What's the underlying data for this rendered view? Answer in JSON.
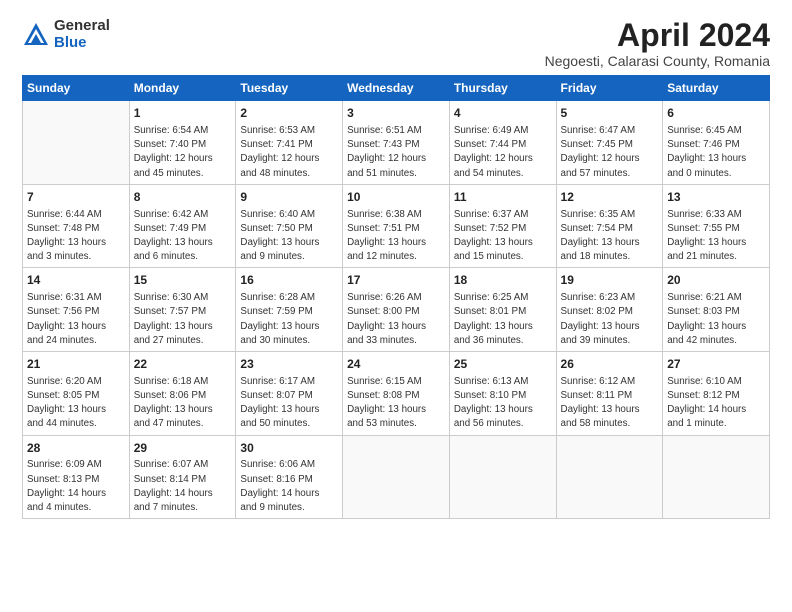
{
  "logo": {
    "general": "General",
    "blue": "Blue"
  },
  "title": "April 2024",
  "subtitle": "Negoesti, Calarasi County, Romania",
  "days_header": [
    "Sunday",
    "Monday",
    "Tuesday",
    "Wednesday",
    "Thursday",
    "Friday",
    "Saturday"
  ],
  "weeks": [
    [
      {
        "num": "",
        "info": ""
      },
      {
        "num": "1",
        "info": "Sunrise: 6:54 AM\nSunset: 7:40 PM\nDaylight: 12 hours\nand 45 minutes."
      },
      {
        "num": "2",
        "info": "Sunrise: 6:53 AM\nSunset: 7:41 PM\nDaylight: 12 hours\nand 48 minutes."
      },
      {
        "num": "3",
        "info": "Sunrise: 6:51 AM\nSunset: 7:43 PM\nDaylight: 12 hours\nand 51 minutes."
      },
      {
        "num": "4",
        "info": "Sunrise: 6:49 AM\nSunset: 7:44 PM\nDaylight: 12 hours\nand 54 minutes."
      },
      {
        "num": "5",
        "info": "Sunrise: 6:47 AM\nSunset: 7:45 PM\nDaylight: 12 hours\nand 57 minutes."
      },
      {
        "num": "6",
        "info": "Sunrise: 6:45 AM\nSunset: 7:46 PM\nDaylight: 13 hours\nand 0 minutes."
      }
    ],
    [
      {
        "num": "7",
        "info": "Sunrise: 6:44 AM\nSunset: 7:48 PM\nDaylight: 13 hours\nand 3 minutes."
      },
      {
        "num": "8",
        "info": "Sunrise: 6:42 AM\nSunset: 7:49 PM\nDaylight: 13 hours\nand 6 minutes."
      },
      {
        "num": "9",
        "info": "Sunrise: 6:40 AM\nSunset: 7:50 PM\nDaylight: 13 hours\nand 9 minutes."
      },
      {
        "num": "10",
        "info": "Sunrise: 6:38 AM\nSunset: 7:51 PM\nDaylight: 13 hours\nand 12 minutes."
      },
      {
        "num": "11",
        "info": "Sunrise: 6:37 AM\nSunset: 7:52 PM\nDaylight: 13 hours\nand 15 minutes."
      },
      {
        "num": "12",
        "info": "Sunrise: 6:35 AM\nSunset: 7:54 PM\nDaylight: 13 hours\nand 18 minutes."
      },
      {
        "num": "13",
        "info": "Sunrise: 6:33 AM\nSunset: 7:55 PM\nDaylight: 13 hours\nand 21 minutes."
      }
    ],
    [
      {
        "num": "14",
        "info": "Sunrise: 6:31 AM\nSunset: 7:56 PM\nDaylight: 13 hours\nand 24 minutes."
      },
      {
        "num": "15",
        "info": "Sunrise: 6:30 AM\nSunset: 7:57 PM\nDaylight: 13 hours\nand 27 minutes."
      },
      {
        "num": "16",
        "info": "Sunrise: 6:28 AM\nSunset: 7:59 PM\nDaylight: 13 hours\nand 30 minutes."
      },
      {
        "num": "17",
        "info": "Sunrise: 6:26 AM\nSunset: 8:00 PM\nDaylight: 13 hours\nand 33 minutes."
      },
      {
        "num": "18",
        "info": "Sunrise: 6:25 AM\nSunset: 8:01 PM\nDaylight: 13 hours\nand 36 minutes."
      },
      {
        "num": "19",
        "info": "Sunrise: 6:23 AM\nSunset: 8:02 PM\nDaylight: 13 hours\nand 39 minutes."
      },
      {
        "num": "20",
        "info": "Sunrise: 6:21 AM\nSunset: 8:03 PM\nDaylight: 13 hours\nand 42 minutes."
      }
    ],
    [
      {
        "num": "21",
        "info": "Sunrise: 6:20 AM\nSunset: 8:05 PM\nDaylight: 13 hours\nand 44 minutes."
      },
      {
        "num": "22",
        "info": "Sunrise: 6:18 AM\nSunset: 8:06 PM\nDaylight: 13 hours\nand 47 minutes."
      },
      {
        "num": "23",
        "info": "Sunrise: 6:17 AM\nSunset: 8:07 PM\nDaylight: 13 hours\nand 50 minutes."
      },
      {
        "num": "24",
        "info": "Sunrise: 6:15 AM\nSunset: 8:08 PM\nDaylight: 13 hours\nand 53 minutes."
      },
      {
        "num": "25",
        "info": "Sunrise: 6:13 AM\nSunset: 8:10 PM\nDaylight: 13 hours\nand 56 minutes."
      },
      {
        "num": "26",
        "info": "Sunrise: 6:12 AM\nSunset: 8:11 PM\nDaylight: 13 hours\nand 58 minutes."
      },
      {
        "num": "27",
        "info": "Sunrise: 6:10 AM\nSunset: 8:12 PM\nDaylight: 14 hours\nand 1 minute."
      }
    ],
    [
      {
        "num": "28",
        "info": "Sunrise: 6:09 AM\nSunset: 8:13 PM\nDaylight: 14 hours\nand 4 minutes."
      },
      {
        "num": "29",
        "info": "Sunrise: 6:07 AM\nSunset: 8:14 PM\nDaylight: 14 hours\nand 7 minutes."
      },
      {
        "num": "30",
        "info": "Sunrise: 6:06 AM\nSunset: 8:16 PM\nDaylight: 14 hours\nand 9 minutes."
      },
      {
        "num": "",
        "info": ""
      },
      {
        "num": "",
        "info": ""
      },
      {
        "num": "",
        "info": ""
      },
      {
        "num": "",
        "info": ""
      }
    ]
  ]
}
